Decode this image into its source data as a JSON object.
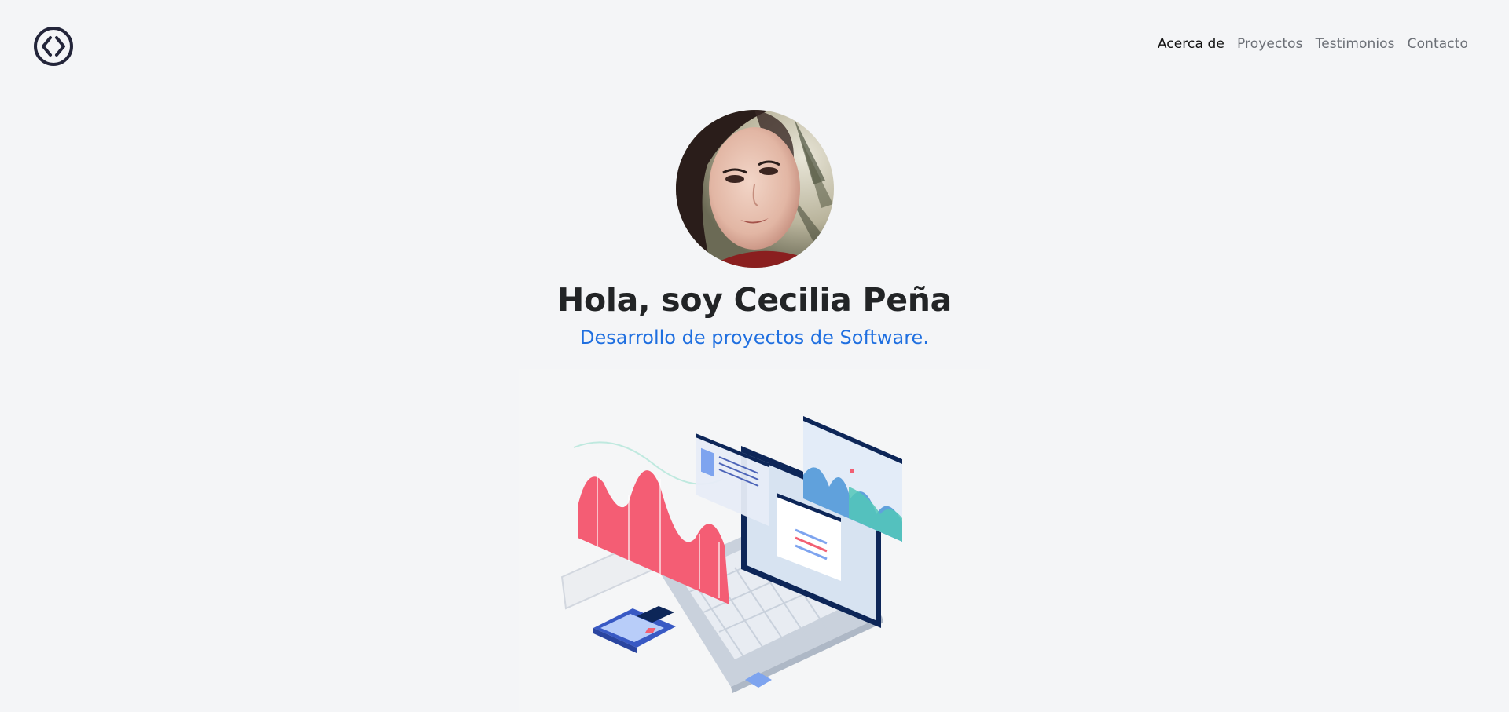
{
  "header": {
    "logo_icon": "code-brackets-icon",
    "nav": {
      "about": "Acerca de",
      "projects": "Proyectos",
      "testimonials": "Testimonios",
      "contact": "Contacto"
    }
  },
  "hero": {
    "title": "Hola, soy Cecilia Peña",
    "subtitle": "Desarrollo de proyectos de Software."
  },
  "colors": {
    "background": "#f4f5f7",
    "accent": "#1f6fe0",
    "title": "#222426",
    "nav_text": "#6b6f76",
    "nav_active": "#111111"
  }
}
